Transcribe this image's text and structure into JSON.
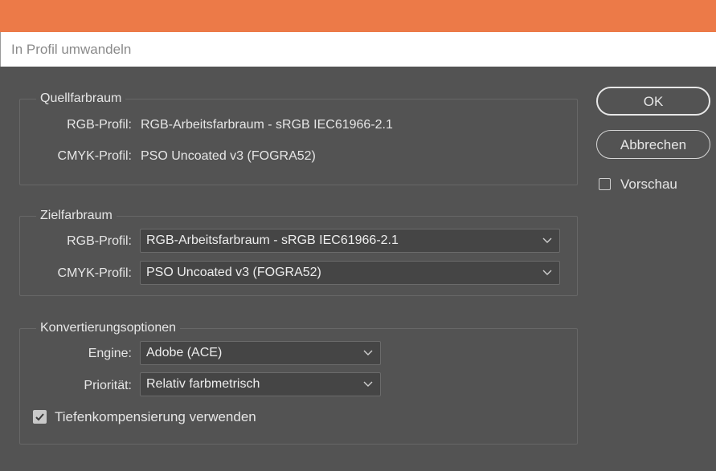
{
  "window": {
    "title": "In Profil umwandeln"
  },
  "source": {
    "legend": "Quellfarbraum",
    "rgb_label": "RGB-Profil:",
    "rgb_value": "RGB-Arbeitsfarbraum - sRGB IEC61966-2.1",
    "cmyk_label": "CMYK-Profil:",
    "cmyk_value": "PSO Uncoated v3 (FOGRA52)"
  },
  "destination": {
    "legend": "Zielfarbraum",
    "rgb_label": "RGB-Profil:",
    "rgb_selected": "RGB-Arbeitsfarbraum - sRGB IEC61966-2.1",
    "cmyk_label": "CMYK-Profil:",
    "cmyk_selected": "PSO Uncoated v3 (FOGRA52)"
  },
  "options": {
    "legend": "Konvertierungsoptionen",
    "engine_label": "Engine:",
    "engine_selected": "Adobe (ACE)",
    "intent_label": "Priorität:",
    "intent_selected": "Relativ farbmetrisch",
    "bpc_label": "Tiefenkompensierung verwenden",
    "bpc_checked": true
  },
  "buttons": {
    "ok": "OK",
    "cancel": "Abbrechen"
  },
  "preview": {
    "label": "Vorschau",
    "checked": false
  },
  "icons": {
    "dropdown": "chevron-down-icon",
    "check": "checkmark-icon"
  },
  "colors": {
    "accent": "#ec7a48",
    "panel": "#535353",
    "field": "#454545"
  }
}
